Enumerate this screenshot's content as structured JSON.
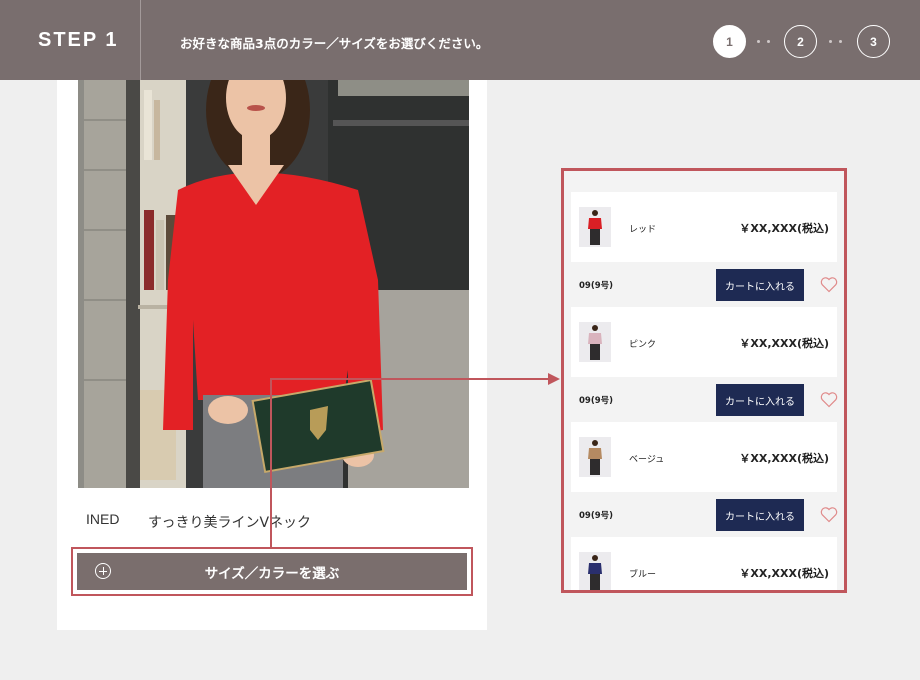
{
  "header": {
    "step_title": "STEP 1",
    "instruction": "お好きな商品3点のカラー／サイズをお選びください。",
    "steps": [
      "1",
      "2",
      "3"
    ]
  },
  "product": {
    "brand": "INED",
    "name": "すっきり美ラインVネック",
    "select_button": "サイズ／カラーを選ぶ"
  },
  "variants": [
    {
      "color": "レッド",
      "price": "￥XX,XXX(税込)",
      "size": "09(9号)",
      "cart_button": "カートに入れる"
    },
    {
      "color": "ピンク",
      "price": "￥XX,XXX(税込)",
      "size": "09(9号)",
      "cart_button": "カートに入れる"
    },
    {
      "color": "ベージュ",
      "price": "￥XX,XXX(税込)",
      "size": "09(9号)",
      "cart_button": "カートに入れる"
    },
    {
      "color": "ブルー",
      "price": "￥XX,XXX(税込)"
    }
  ],
  "colors": {
    "header_bg": "#796e6e",
    "highlight": "#c0565c",
    "cart_button": "#1e2a53",
    "select_button": "#7a6e6d",
    "heart": "#e08a8a"
  }
}
